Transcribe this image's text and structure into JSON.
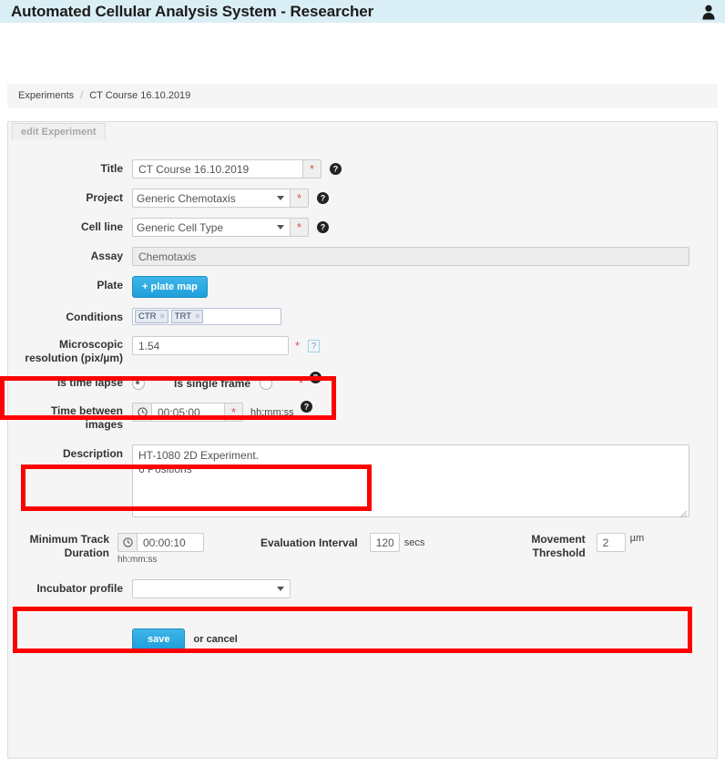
{
  "header": {
    "title": "Automated Cellular Analysis System - Researcher",
    "user_icon": "user-avatar-icon",
    "background": "#daeef5"
  },
  "breadcrumb": {
    "root": "Experiments",
    "separator": "/",
    "current": "CT Course 16.10.2019"
  },
  "panel": {
    "tab_label": "edit Experiment"
  },
  "form": {
    "title": {
      "label": "Title",
      "value": "CT Course 16.10.2019",
      "required_marker": "*",
      "help_icon": "help-circle-icon"
    },
    "project": {
      "label": "Project",
      "value": "Generic Chemotaxis",
      "required_marker": "*",
      "help_icon": "help-circle-icon"
    },
    "cell_line": {
      "label": "Cell line",
      "value": "Generic Cell Type",
      "required_marker": "*",
      "help_icon": "help-circle-icon"
    },
    "assay": {
      "label": "Assay",
      "value": "Chemotaxis"
    },
    "plate": {
      "label": "Plate",
      "button_label": "+ plate map"
    },
    "conditions": {
      "label": "Conditions",
      "tags": [
        "CTR",
        "TRT"
      ],
      "remove_glyph": "×"
    },
    "microscopic_resolution": {
      "label_line1": "Microscopic",
      "label_line2": "resolution (pix/µm)",
      "value": "1.54",
      "required_marker": "*",
      "help_icon": "broken-image-help-icon",
      "help_glyph": "?"
    },
    "frame_mode": {
      "time_lapse_label": "Is time lapse",
      "single_frame_label": "Is single frame",
      "selected": "time_lapse",
      "required_marker": "*",
      "help_icon": "help-circle-icon"
    },
    "time_between_images": {
      "label_line1": "Time between",
      "label_line2": "images",
      "value": "00:05:00",
      "required_marker": "*",
      "format_hint": "hh:mm:ss",
      "clock_icon": "clock-icon",
      "help_icon": "help-circle-icon"
    },
    "description": {
      "label": "Description",
      "value": "HT-1080 2D Experiment.\n6 Positions"
    },
    "minimum_track_duration": {
      "label_line1": "Minimum Track",
      "label_line2": "Duration",
      "value": "00:00:10",
      "format_hint": "hh:mm:ss",
      "clock_icon": "clock-icon"
    },
    "evaluation_interval": {
      "label": "Evaluation Interval",
      "value": "120",
      "unit": "secs"
    },
    "movement_threshold": {
      "label_line1": "Movement",
      "label_line2": "Threshold",
      "value": "2",
      "unit": "µm"
    },
    "incubator_profile": {
      "label": "Incubator profile",
      "value": ""
    }
  },
  "footer": {
    "save_label": "save",
    "or_text": "or",
    "cancel_label": "cancel"
  },
  "annotations": {
    "highlight_color": "#fe0000",
    "boxes": [
      "microscopic-resolution-row",
      "time-between-images-row",
      "tracking-parameters-row"
    ]
  }
}
